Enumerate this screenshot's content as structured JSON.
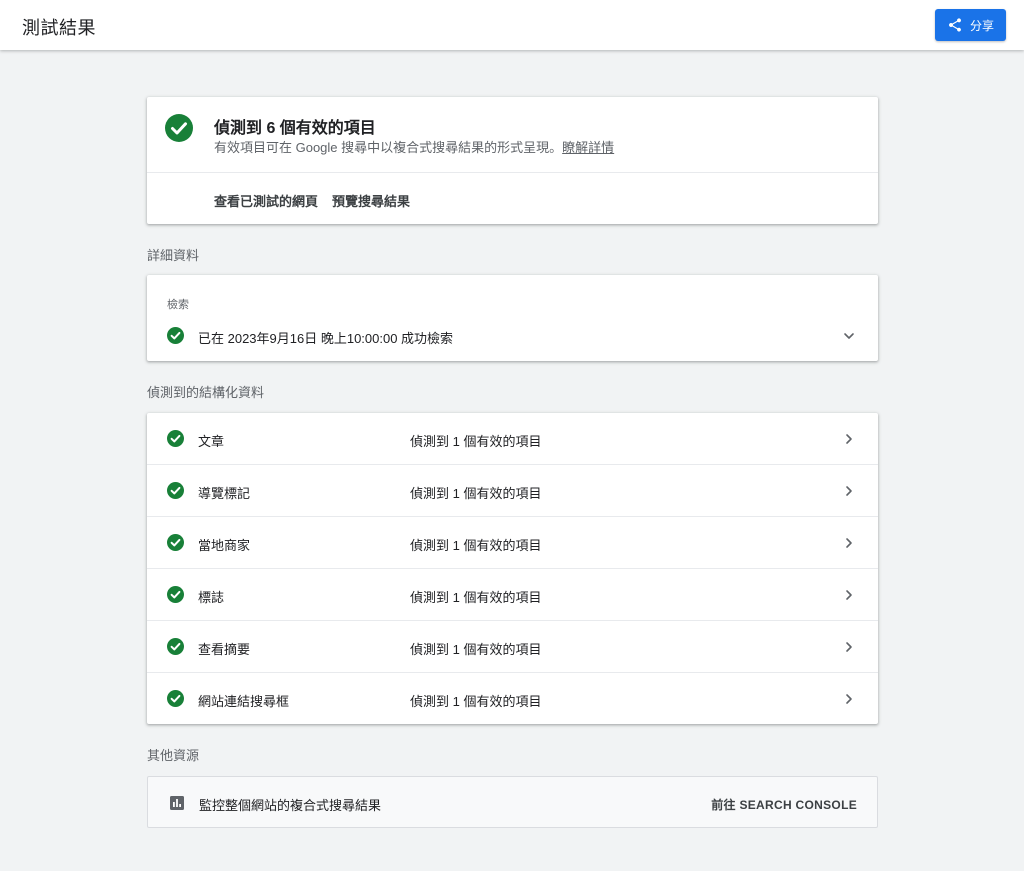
{
  "header": {
    "title": "測試結果",
    "share_label": "分享"
  },
  "summary": {
    "headline": "偵測到 6 個有效的項目",
    "subtitle": "有效項目可在 Google 搜尋中以複合式搜尋結果的形式呈現。",
    "learn_more": "瞭解詳情",
    "actions": [
      "查看已測試的網頁",
      "預覽搜尋結果"
    ]
  },
  "details": {
    "section_label": "詳細資料",
    "crawl_label": "檢索",
    "crawl_status": "已在 2023年9月16日 晚上10:00:00 成功檢索"
  },
  "structured_data": {
    "section_label": "偵測到的結構化資料",
    "items": [
      {
        "name": "文章",
        "status": "偵測到 1 個有效的項目"
      },
      {
        "name": "導覽標記",
        "status": "偵測到 1 個有效的項目"
      },
      {
        "name": "當地商家",
        "status": "偵測到 1 個有效的項目"
      },
      {
        "name": "標誌",
        "status": "偵測到 1 個有效的項目"
      },
      {
        "name": "查看摘要",
        "status": "偵測到 1 個有效的項目"
      },
      {
        "name": "網站連結搜尋框",
        "status": "偵測到 1 個有效的項目"
      }
    ]
  },
  "other_resources": {
    "section_label": "其他資源",
    "item_label": "監控整個網站的複合式搜尋結果",
    "link_label": "前往 SEARCH CONSOLE"
  },
  "colors": {
    "success_green": "#188038",
    "accent_blue": "#1a73e8"
  }
}
